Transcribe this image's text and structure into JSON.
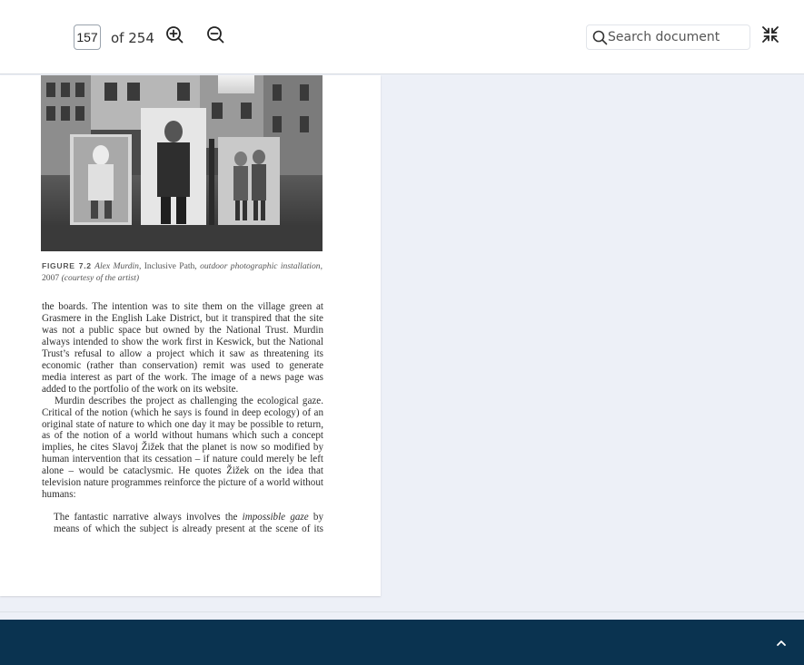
{
  "toolbar": {
    "page_input_value": "157",
    "page_total_label": "of 254",
    "zoom_in_icon": "zoom-in-icon",
    "zoom_out_icon": "zoom-out-icon",
    "search_placeholder": "Search document",
    "search_icon": "search-icon",
    "collapse_icon": "collapse-fullscreen-icon"
  },
  "document": {
    "figure_image": "grayscale photograph of outdoor photographic installation boards in a village street",
    "caption": {
      "label": "FIGURE 7.2",
      "author": "Alex Murdin,",
      "title": "Inclusive Path,",
      "desc": "outdoor photographic installation,",
      "year": "2007",
      "credit": "(courtesy of the artist)"
    },
    "paragraphs": [
      "the boards. The intention was to site them on the village green at Grasmere in the English Lake District, but it transpired that the site was not a public space but owned by the National Trust. Murdin always intended to show the work first in Keswick, but the National Trust’s refusal to allow a project which it saw as threatening its economic (rather than conservation) remit was used to generate media interest as part of the work. The image of a news page was added to the portfolio of the work on its website.",
      "Murdin describes the project as challenging the ecological gaze. Critical of the notion (which he says is found in deep ecology) of an original state of nature to which one day it may be possible to return, as of the notion of a world without humans which such a concept implies, he cites Slavoj Žižek that the planet is now so modified by human intervention that its cessation – if nature could merely be left alone – would be cataclysmic. He quotes Žižek on the idea that television nature programmes reinforce the picture of a world without humans:"
    ],
    "quote": {
      "pre": "The fantastic narrative always involves the",
      "em": "impossible gaze",
      "post": "by means of which the subject is already present at the scene of its"
    }
  },
  "footer": {
    "scroll_top_icon": "chevron-up-icon",
    "background": "#0a3350"
  },
  "colors": {
    "viewer_background": "#edf0f7",
    "toolbar_background": "#ffffff"
  }
}
